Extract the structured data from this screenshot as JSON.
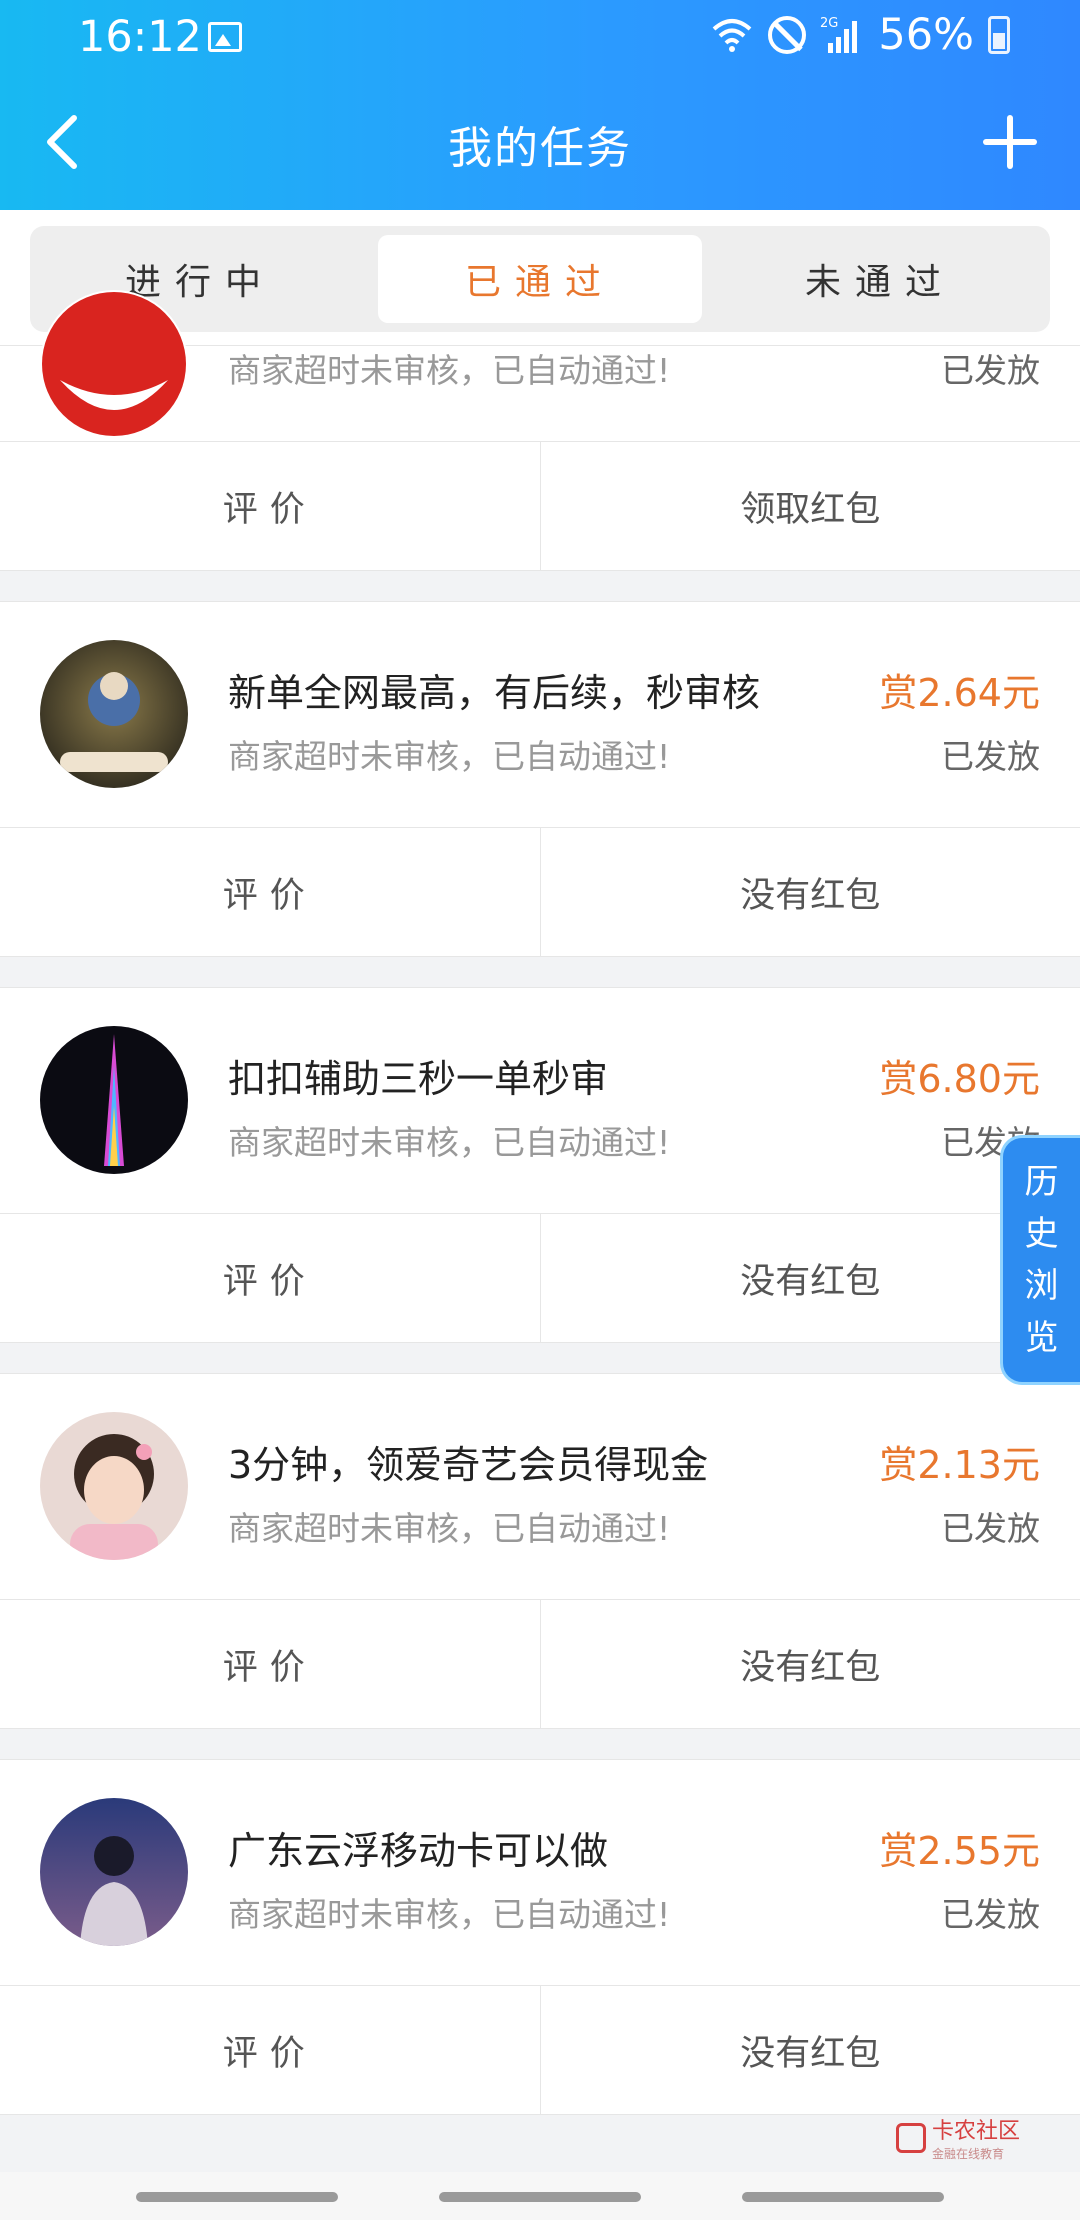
{
  "status_bar": {
    "time": "16:12",
    "network": "2G",
    "battery": "56%"
  },
  "header": {
    "title": "我的任务"
  },
  "tabs": [
    {
      "label": "进行中"
    },
    {
      "label": "已通过"
    },
    {
      "label": "未通过"
    }
  ],
  "tabs_active": "已通过",
  "tasks": [
    {
      "title": "",
      "subtitle": "商家超时未审核，已自动通过!",
      "reward": "",
      "status": "已发放",
      "actions": [
        "评价",
        "领取红包"
      ]
    },
    {
      "title": "新单全网最高，有后续，秒审核",
      "subtitle": "商家超时未审核，已自动通过!",
      "reward": "赏2.64元",
      "status": "已发放",
      "actions": [
        "评价",
        "没有红包"
      ]
    },
    {
      "title": "扣扣辅助三秒一单秒审",
      "subtitle": "商家超时未审核，已自动通过!",
      "reward": "赏6.80元",
      "status": "已发放",
      "actions": [
        "评价",
        "没有红包"
      ]
    },
    {
      "title": "3分钟，领爱奇艺会员得现金",
      "subtitle": "商家超时未审核，已自动通过!",
      "reward": "赏2.13元",
      "status": "已发放",
      "actions": [
        "评价",
        "没有红包"
      ]
    },
    {
      "title": "广东云浮移动卡可以做",
      "subtitle": "商家超时未审核，已自动通过!",
      "reward": "赏2.55元",
      "status": "已发放",
      "actions": [
        "评价",
        "没有红包"
      ]
    }
  ],
  "history_button": {
    "label": [
      "历",
      "史",
      "浏",
      "览"
    ]
  },
  "watermark": {
    "name": "卡农社区",
    "tagline": "金融在线教育"
  },
  "colors": {
    "accent": "#e8772e",
    "header_start": "#18b9f2",
    "header_end": "#2f88ff",
    "history_bg": "#2d8cf0"
  }
}
